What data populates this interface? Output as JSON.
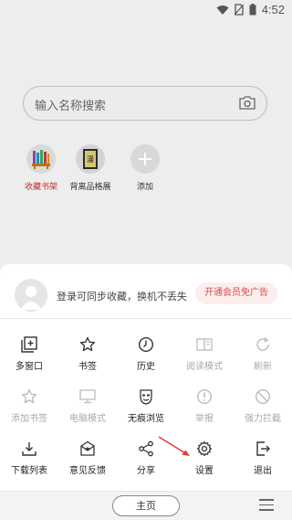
{
  "status_bar": {
    "time": "4:52"
  },
  "home": {
    "search": {
      "placeholder": "输入名称搜索"
    },
    "shortcuts": [
      {
        "label": "收藏书架",
        "icon": "bookshelf-icon",
        "active": true
      },
      {
        "label": "背离品格展",
        "icon": "book-cover-icon",
        "active": false
      },
      {
        "label": "添加",
        "icon": "plus-icon",
        "active": false
      }
    ]
  },
  "sheet": {
    "login_text": "登录可同步收藏，换机不丢失",
    "vip_button": "开通会员免广告",
    "rows": [
      [
        {
          "label": "多窗口",
          "icon": "multi-window-icon",
          "enabled": true
        },
        {
          "label": "书签",
          "icon": "star-icon",
          "enabled": true
        },
        {
          "label": "历史",
          "icon": "clock-icon",
          "enabled": true
        },
        {
          "label": "阅读模式",
          "icon": "book-icon",
          "enabled": false
        },
        {
          "label": "刷新",
          "icon": "refresh-icon",
          "enabled": false
        }
      ],
      [
        {
          "label": "添加书签",
          "icon": "star-plus-icon",
          "enabled": false
        },
        {
          "label": "电脑模式",
          "icon": "monitor-icon",
          "enabled": false
        },
        {
          "label": "无痕浏览",
          "icon": "mask-icon",
          "enabled": true
        },
        {
          "label": "举报",
          "icon": "alert-icon",
          "enabled": false
        },
        {
          "label": "强力拦截",
          "icon": "block-icon",
          "enabled": false
        }
      ],
      [
        {
          "label": "下载列表",
          "icon": "download-icon",
          "enabled": true
        },
        {
          "label": "意见反馈",
          "icon": "feedback-icon",
          "enabled": true
        },
        {
          "label": "分享",
          "icon": "share-icon",
          "enabled": true
        },
        {
          "label": "设置",
          "icon": "gear-icon",
          "enabled": true
        },
        {
          "label": "退出",
          "icon": "exit-icon",
          "enabled": true
        }
      ]
    ]
  },
  "bottom_bar": {
    "home_label": "主页"
  },
  "colors": {
    "accent": "#d94a4a",
    "annotation": "#e53935"
  }
}
